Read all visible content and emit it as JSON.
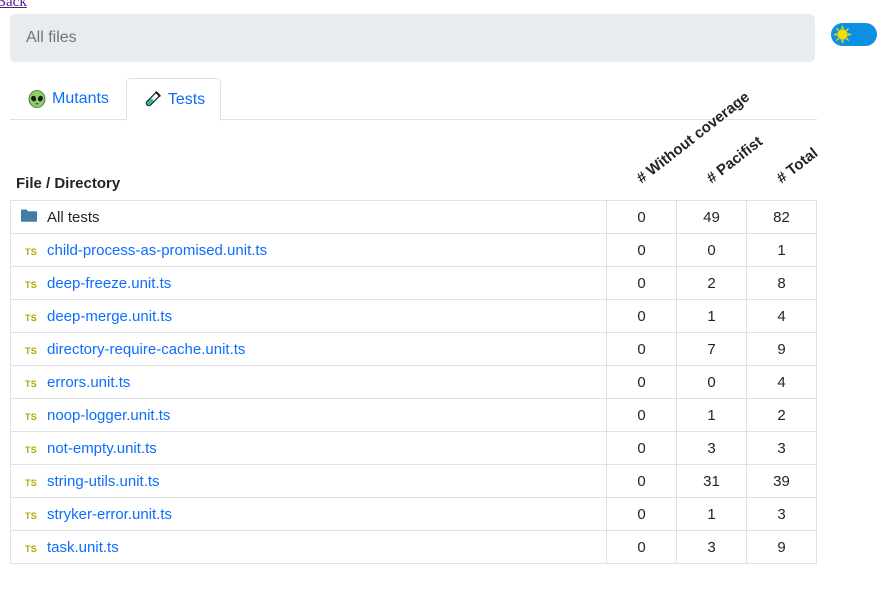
{
  "back_link": "Back",
  "breadcrumb": "All files",
  "tabs": [
    {
      "label": "Mutants",
      "icon": "alien-icon"
    },
    {
      "label": "Tests",
      "icon": "test-tube-icon",
      "active": true
    }
  ],
  "columns": {
    "file": "File / Directory",
    "without_coverage": "# Without coverage",
    "pacifist": "# Pacifist",
    "total": "# Total"
  },
  "rows": [
    {
      "name": "All tests",
      "type": "directory",
      "without_coverage": "0",
      "pacifist": "49",
      "total": "82"
    },
    {
      "name": "child-process-as-promised.unit.ts",
      "type": "file",
      "without_coverage": "0",
      "pacifist": "0",
      "total": "1"
    },
    {
      "name": "deep-freeze.unit.ts",
      "type": "file",
      "without_coverage": "0",
      "pacifist": "2",
      "total": "8"
    },
    {
      "name": "deep-merge.unit.ts",
      "type": "file",
      "without_coverage": "0",
      "pacifist": "1",
      "total": "4"
    },
    {
      "name": "directory-require-cache.unit.ts",
      "type": "file",
      "without_coverage": "0",
      "pacifist": "7",
      "total": "9"
    },
    {
      "name": "errors.unit.ts",
      "type": "file",
      "without_coverage": "0",
      "pacifist": "0",
      "total": "4"
    },
    {
      "name": "noop-logger.unit.ts",
      "type": "file",
      "without_coverage": "0",
      "pacifist": "1",
      "total": "2"
    },
    {
      "name": "not-empty.unit.ts",
      "type": "file",
      "without_coverage": "0",
      "pacifist": "3",
      "total": "3"
    },
    {
      "name": "string-utils.unit.ts",
      "type": "file",
      "without_coverage": "0",
      "pacifist": "31",
      "total": "39"
    },
    {
      "name": "stryker-error.unit.ts",
      "type": "file",
      "without_coverage": "0",
      "pacifist": "1",
      "total": "3"
    },
    {
      "name": "task.unit.ts",
      "type": "file",
      "without_coverage": "0",
      "pacifist": "3",
      "total": "9"
    }
  ],
  "file_badge": "TS",
  "colors": {
    "link": "#0d6efd",
    "toggle": "#0d8fe6",
    "ts_badge": "#b5a600",
    "folder": "#3f7ea6"
  }
}
